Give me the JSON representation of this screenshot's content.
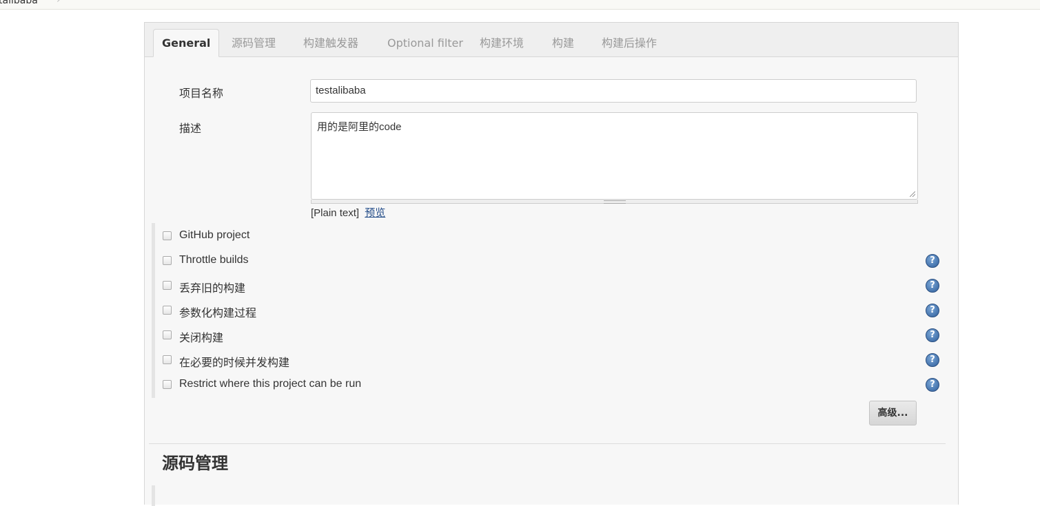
{
  "breadcrumb": {
    "text": "talibaba",
    "separator": "›"
  },
  "tabs": [
    {
      "label": "General",
      "active": true
    },
    {
      "label": "源码管理"
    },
    {
      "label": "构建触发器"
    },
    {
      "label": "Optional filter"
    },
    {
      "label": "构建环境"
    },
    {
      "label": "构建"
    },
    {
      "label": "构建后操作"
    }
  ],
  "general": {
    "project_name_label": "项目名称",
    "project_name_value": "testalibaba",
    "description_label": "描述",
    "description_value": "用的是阿里的code",
    "plain_text": "[Plain text]",
    "preview_link": "预览"
  },
  "options": [
    {
      "label": "GitHub project",
      "checked": false,
      "help": false
    },
    {
      "label": "Throttle builds",
      "checked": false,
      "help": true
    },
    {
      "label": "丢弃旧的构建",
      "checked": false,
      "help": true
    },
    {
      "label": "参数化构建过程",
      "checked": false,
      "help": true
    },
    {
      "label": "关闭构建",
      "checked": false,
      "help": true
    },
    {
      "label": "在必要的时候并发构建",
      "checked": false,
      "help": true
    },
    {
      "label": "Restrict where this project can be run",
      "checked": false,
      "help": true
    }
  ],
  "advanced_button": "高级...",
  "scm_section_title": "源码管理",
  "colors": {
    "link": "#204a87",
    "help_icon": "#2f5f9c"
  }
}
